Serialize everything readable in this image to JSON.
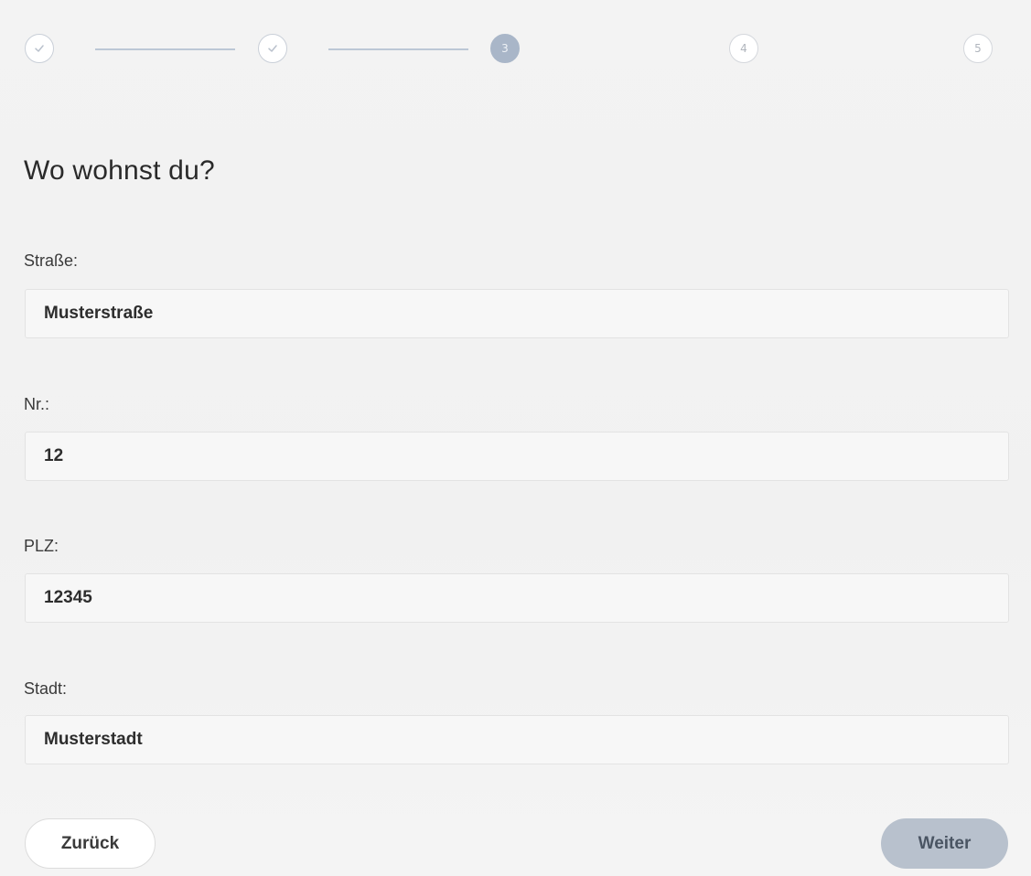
{
  "stepper": {
    "steps": [
      {
        "state": "done",
        "label": "",
        "icon": "check-icon"
      },
      {
        "state": "done",
        "label": "",
        "icon": "check-icon"
      },
      {
        "state": "active",
        "label": "3"
      },
      {
        "state": "todo",
        "label": "4"
      },
      {
        "state": "todo",
        "label": "5"
      }
    ],
    "colors": {
      "active": "#a9b6c8",
      "done_border": "#c9cfd8",
      "connector": "#bcc7d6"
    }
  },
  "heading": "Wo wohnst du?",
  "form": {
    "street": {
      "label": "Straße:",
      "value": "Musterstraße"
    },
    "number": {
      "label": "Nr.:",
      "value": "12"
    },
    "zip": {
      "label": "PLZ:",
      "value": "12345"
    },
    "city": {
      "label": "Stadt:",
      "value": "Musterstadt"
    }
  },
  "buttons": {
    "back_label": "Zurück",
    "next_label": "Weiter",
    "next_color": "#b8c1cd"
  }
}
